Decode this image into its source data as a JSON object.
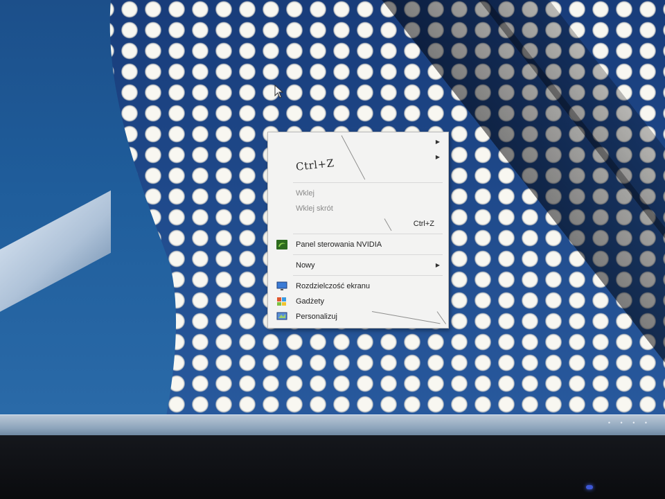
{
  "desktop": {
    "wallpaper": "building-facade-discs",
    "accent_colors": {
      "sky": "#1f5d9b",
      "menu_bg": "#f3f3f2",
      "menu_disabled_text": "#8a8a8a"
    }
  },
  "context_menu": {
    "handwritten_note": "Ctrl+Z",
    "items": [
      {
        "label": "",
        "has_submenu": true
      },
      {
        "label": "",
        "has_submenu": true
      },
      {
        "label": "Wklej",
        "disabled": true
      },
      {
        "label": "Wklej skrót",
        "disabled": true
      },
      {
        "label": "",
        "shortcut": "Ctrl+Z"
      },
      {
        "label": "Panel sterowania NVIDIA",
        "icon": "nvidia-icon"
      },
      {
        "label": "Nowy",
        "has_submenu": true
      },
      {
        "label": "Rozdzielczość ekranu",
        "icon": "display-resolution-icon"
      },
      {
        "label": "Gadżety",
        "icon": "gadgets-icon"
      },
      {
        "label": "Personalizuj",
        "icon": "personalize-icon"
      }
    ]
  }
}
